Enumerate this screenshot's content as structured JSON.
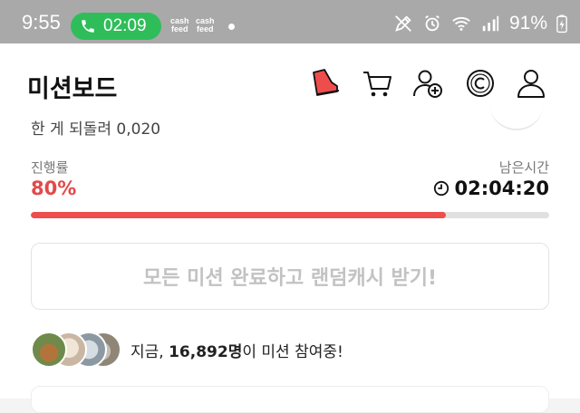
{
  "status_bar": {
    "time": "9:55",
    "call_timer": "02:09",
    "notif_icons": [
      [
        "cash",
        "feed"
      ],
      [
        "cash",
        "feed"
      ]
    ],
    "battery": "91%"
  },
  "app_bar": {
    "title": "미션보드",
    "icons": [
      "sneaker-icon",
      "cart-icon",
      "add-friend-icon",
      "coin-icon",
      "profile-icon"
    ]
  },
  "mission": {
    "peek_text": "한 게 되돌려 0,020",
    "progress_label": "진행률",
    "progress_value": "80%",
    "progress_fraction": 0.8,
    "remaining_label": "남은시간",
    "remaining_time": "02:04:20",
    "cta_label": "모든 미션 완료하고 랜덤캐시 받기!",
    "participants_prefix": "지금, ",
    "participants_count": "16,892명",
    "participants_suffix": "이 미션 참여중!"
  },
  "colors": {
    "accent": "#ee4d4d",
    "accent_text": "#e24a4a",
    "call_green": "#2fbd5a",
    "statusbar_bg": "#a9a9a9"
  }
}
